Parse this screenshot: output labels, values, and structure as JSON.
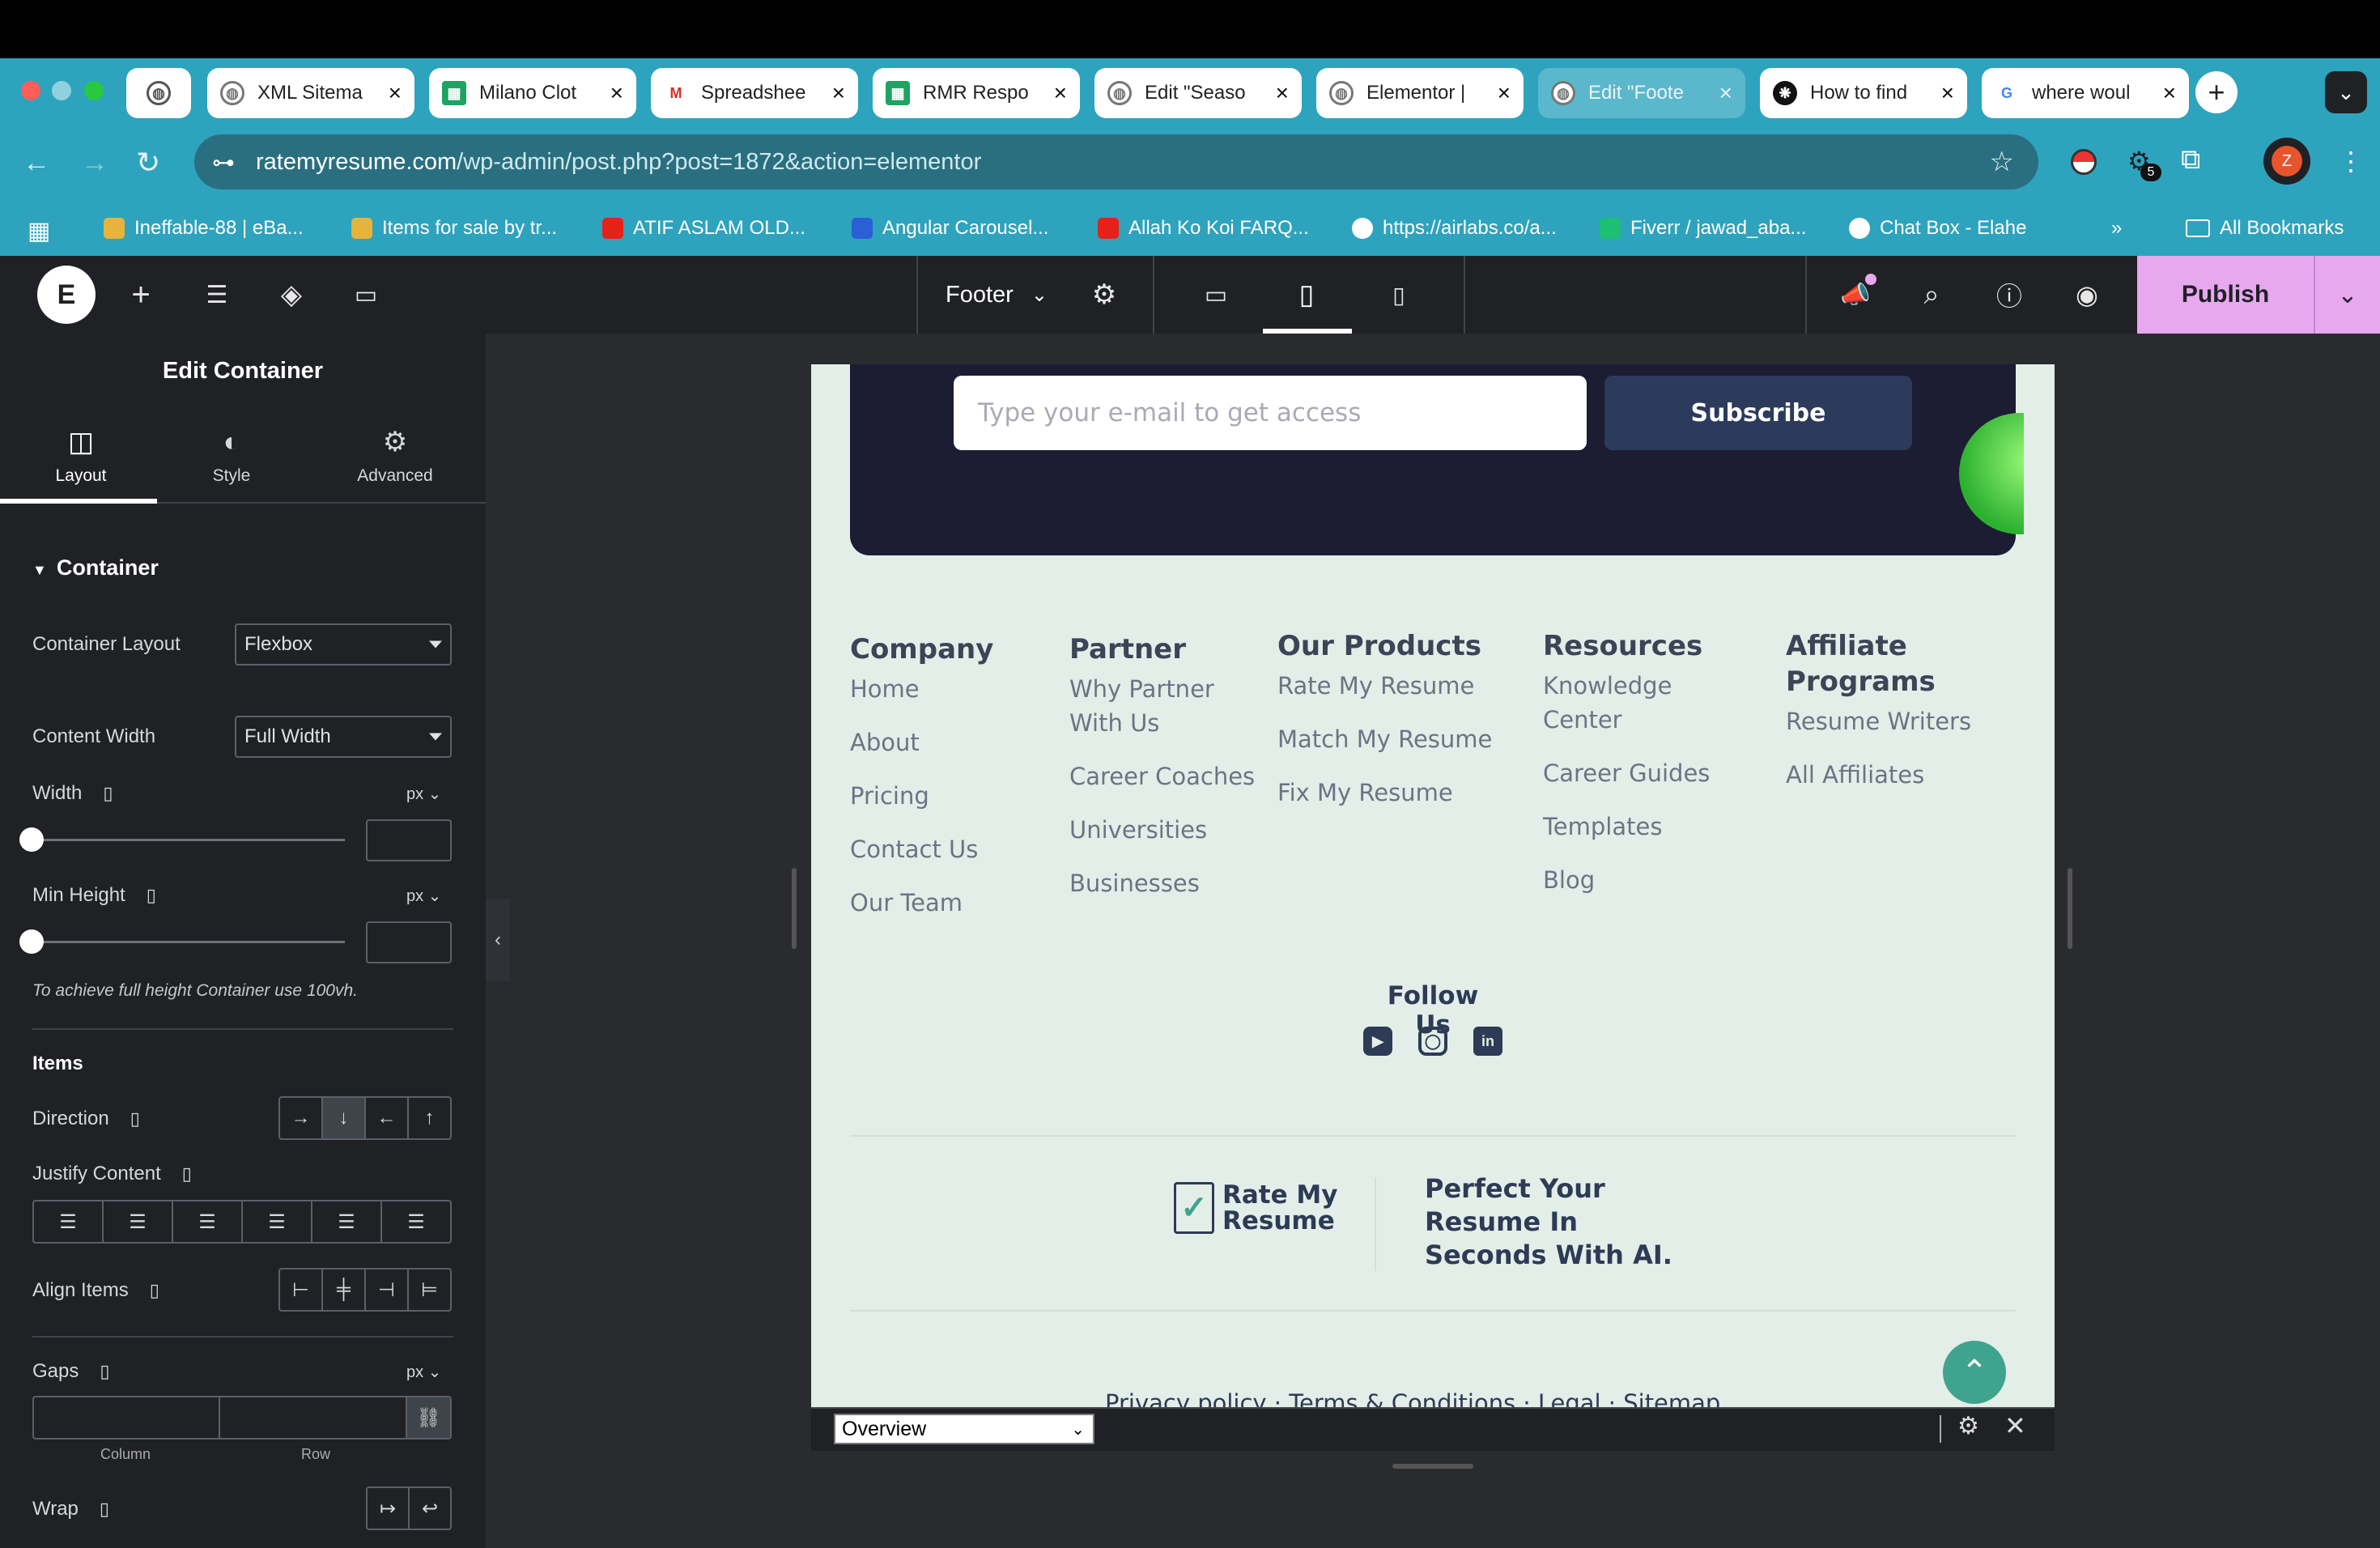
{
  "browser": {
    "tabs": [
      {
        "title": "XML Sitema",
        "fav": "globe-icon"
      },
      {
        "title": "Milano Clot",
        "fav": "sheets-icon"
      },
      {
        "title": "Spreadshee",
        "fav": "gmail-icon"
      },
      {
        "title": "RMR Respo",
        "fav": "sheets-icon"
      },
      {
        "title": "Edit \"Seaso",
        "fav": "globe-icon"
      },
      {
        "title": "Elementor |",
        "fav": "globe-icon"
      },
      {
        "title": "Edit \"Foote",
        "fav": "globe-icon"
      },
      {
        "title": "How to find",
        "fav": "openai-icon"
      },
      {
        "title": "where woul",
        "fav": "google-icon"
      }
    ],
    "url_domain": "ratemyresume.com",
    "url_path": "/wp-admin/post.php?post=1872&action=elementor",
    "extension_badge": "5",
    "profile_initial": "Z",
    "bookmarks": [
      "Ineffable-88 | eBa...",
      "Items for sale by tr...",
      "ATIF ASLAM OLD...",
      "Angular Carousel...",
      "Allah Ko Koi FARQ...",
      "https://airlabs.co/a...",
      "Fiverr / jawad_aba...",
      "Chat Box - Elahe"
    ],
    "bookmarks_more": "»",
    "all_bookmarks": "All Bookmarks"
  },
  "editor": {
    "document_name": "Footer",
    "publish_label": "Publish",
    "panel_title": "Edit Container",
    "tabs": [
      "Layout",
      "Style",
      "Advanced"
    ],
    "section": "Container",
    "container_layout_label": "Container Layout",
    "container_layout_value": "Flexbox",
    "content_width_label": "Content Width",
    "content_width_value": "Full Width",
    "width_label": "Width",
    "width_unit": "px",
    "min_height_label": "Min Height",
    "min_height_unit": "px",
    "min_height_hint": "To achieve full height Container use 100vh.",
    "items_heading": "Items",
    "direction_label": "Direction",
    "justify_label": "Justify Content",
    "align_label": "Align Items",
    "gaps_label": "Gaps",
    "gaps_unit": "px",
    "gap_column": "Column",
    "gap_row": "Row",
    "wrap_label": "Wrap"
  },
  "site": {
    "email_placeholder": "Type your e-mail to get access",
    "subscribe": "Subscribe",
    "columns": [
      {
        "heading": "Company",
        "links": [
          "Home",
          "About",
          "Pricing",
          "Contact Us",
          "Our Team"
        ]
      },
      {
        "heading": "Partner",
        "links": [
          "Why Partner With Us",
          "Career Coaches",
          "Universities",
          "Businesses"
        ]
      },
      {
        "heading": "Our Products",
        "links": [
          "Rate My Resume",
          "Match My Resume",
          "Fix My Resume"
        ]
      },
      {
        "heading": "Resources",
        "links": [
          "Knowledge Center",
          "Career Guides",
          "Templates",
          "Blog"
        ]
      },
      {
        "heading": "Affiliate Programs",
        "links": [
          "Resume Writers",
          "All Affiliates"
        ]
      }
    ],
    "follow_us": "Follow Us",
    "logo_line1": "Rate My",
    "logo_line2": "Resume",
    "tagline": "Perfect Your Resume In Seconds With AI.",
    "legal_links": "Privacy policy  ·  Terms & Conditions  ·  Legal  ·  Sitemap"
  },
  "navigator": {
    "select": "Overview"
  }
}
